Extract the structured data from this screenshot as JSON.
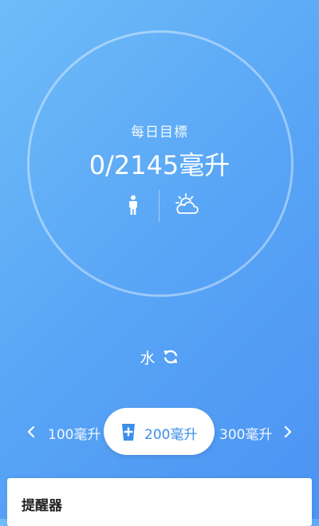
{
  "summary": {
    "goal_label": "每日目標",
    "goal_value": "0/2145毫升",
    "profile_icon": "person-icon",
    "weather_icon": "partly-cloudy-weather-icon"
  },
  "drink": {
    "type_label": "水",
    "swap_icon": "refresh-icon"
  },
  "amounts": {
    "previous": "100毫升",
    "selected": "200毫升",
    "next": "300毫升",
    "selected_icon": "water-cup-plus-icon"
  },
  "reminder": {
    "title": "提醒器"
  },
  "colors": {
    "background_start": "#6fbcf8",
    "background_end": "#4c93f3",
    "accent": "#3d8eea",
    "card": "#ffffff"
  }
}
